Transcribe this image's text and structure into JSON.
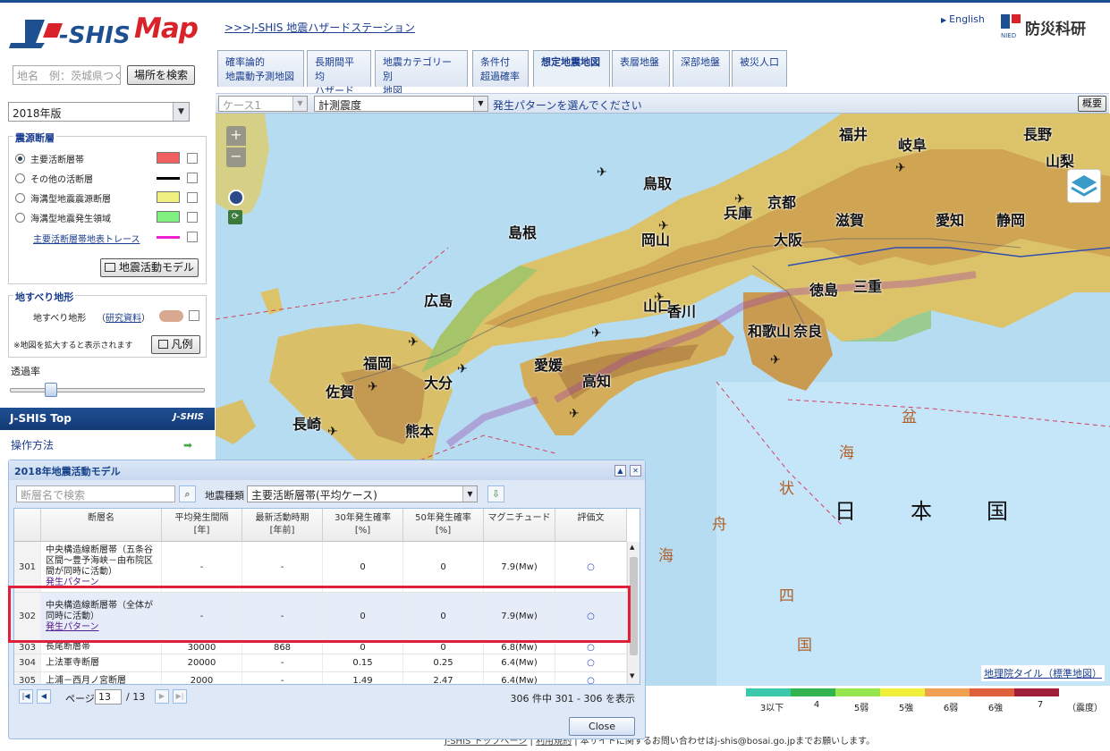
{
  "header": {
    "logo_text": "J-SHIS Map",
    "station_link": ">>>J-SHIS 地震ハザードステーション",
    "english_link": "English",
    "nied_name": "防災科研",
    "nied_abbr": "NIED"
  },
  "sidebar": {
    "search_placeholder": "地名　例：茨城県つくば市",
    "search_button": "場所を検索",
    "year_value": "2018年版",
    "fault_panel_title": "震源断層",
    "fault_items": [
      {
        "label": "主要活断層帯",
        "selected": true,
        "swatch": "#f06060"
      },
      {
        "label": "その他の活断層",
        "selected": false,
        "swatch": "#000000"
      },
      {
        "label": "海溝型地震震源断層",
        "selected": false,
        "swatch": "#f0f080"
      },
      {
        "label": "海溝型地震発生領域",
        "selected": false,
        "swatch": "#80f080"
      }
    ],
    "trace_link": "主要活断層帯地表トレース",
    "activity_model_button": "地震活動モデル",
    "landslide_title": "地すべり地形",
    "landslide_label": "地すべり地形",
    "research_link": "研究資料",
    "zoom_note": "※地図を拡大すると表示されます",
    "legend_button": "凡例",
    "opacity_label": "透過率",
    "opacity": 0.2,
    "jshis_top": "J-SHIS Top",
    "jshis_logo": "J-SHIS",
    "howto": "操作方法"
  },
  "tabs": [
    {
      "label": "確率論的\n地震動予測地図"
    },
    {
      "label": "長期間平均\nハザード"
    },
    {
      "label": "地震カテゴリー別\n地図"
    },
    {
      "label": "条件付\n超過確率"
    },
    {
      "label": "想定地震地図"
    },
    {
      "label": "表層地盤"
    },
    {
      "label": "深部地盤"
    },
    {
      "label": "被災人口"
    }
  ],
  "toolbar": {
    "case_value": "ケース1",
    "measure_value": "計測震度",
    "hint": "発生パターンを選んでください",
    "overview_button": "概要"
  },
  "map": {
    "prefectures": [
      "福井",
      "岐阜",
      "長野",
      "山梨",
      "鳥取",
      "兵庫",
      "京都",
      "滋賀",
      "愛知",
      "静岡",
      "島根",
      "岡山",
      "大阪",
      "三重",
      "広島",
      "山口",
      "香川",
      "徳島",
      "奈良",
      "和歌山",
      "福岡",
      "大分",
      "愛媛",
      "高知",
      "佐賀",
      "長崎",
      "熊本"
    ],
    "sea_labels": [
      "日",
      "本",
      "国"
    ],
    "ocean_chars": [
      "盆",
      "海",
      "状",
      "舟",
      "海",
      "四",
      "国"
    ],
    "attribution": "地理院タイル（標準地図）"
  },
  "intensity_legend": {
    "labels": [
      "3以下",
      "4",
      "5弱",
      "5強",
      "6弱",
      "6強",
      "7",
      "（震度）"
    ],
    "colors": [
      "#3cc8aa",
      "#32b450",
      "#96e650",
      "#f0f03c",
      "#f0a050",
      "#e0603c",
      "#a01e3c"
    ]
  },
  "footer": {
    "link1": "J-SHIS トップページ",
    "link2": "利用規約",
    "text": "本サイトに関するお問い合わせは",
    "email": "j-shis@bosai.go.jp",
    "suffix": "までお願いします。"
  },
  "dialog": {
    "title": "2018年地震活動モデル",
    "search_placeholder": "断層名で検索",
    "kind_label": "地震種類",
    "kind_value": "主要活断層帯(平均ケース)",
    "columns": [
      "断層名",
      "平均発生間隔\n[年]",
      "最新活動時期\n[年前]",
      "30年発生確率\n[%]",
      "50年発生確率\n[%]",
      "マグニチュード",
      "評価文"
    ],
    "rows": [
      {
        "no": "301",
        "name": "中央構造線断層帯（五条谷区間～豊予海峡－由布院区間が同時に活動）",
        "pattern": "発生パターン",
        "interval": "-",
        "latest": "-",
        "p30": "0",
        "p50": "0",
        "mag": "7.9(Mw)",
        "eval": "○"
      },
      {
        "no": "302",
        "name": "中央構造線断層帯（全体が同時に活動）",
        "pattern": "発生パターン",
        "interval": "-",
        "latest": "-",
        "p30": "0",
        "p50": "0",
        "mag": "7.9(Mw)",
        "eval": "○"
      },
      {
        "no": "303",
        "name": "長尾断層帯",
        "pattern": "",
        "interval": "30000",
        "latest": "868",
        "p30": "0",
        "p50": "0",
        "mag": "6.8(Mw)",
        "eval": "○"
      },
      {
        "no": "304",
        "name": "上法軍寺断層",
        "pattern": "",
        "interval": "20000",
        "latest": "-",
        "p30": "0.15",
        "p50": "0.25",
        "mag": "6.4(Mw)",
        "eval": "○"
      },
      {
        "no": "305",
        "name": "上浦－西月ノ宮断層",
        "pattern": "",
        "interval": "2000",
        "latest": "-",
        "p30": "1.49",
        "p50": "2.47",
        "mag": "6.4(Mw)",
        "eval": "○"
      }
    ],
    "page_label": "ページ",
    "page_value": "13",
    "page_total": "/ 13",
    "summary": "306 件中 301 - 306 を表示",
    "close": "Close"
  }
}
